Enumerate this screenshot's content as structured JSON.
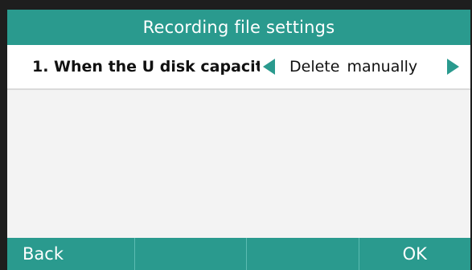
{
  "title": "Recording file settings",
  "setting": {
    "label": "1. When the U disk capacit",
    "value": "Delete manually"
  },
  "softkeys": [
    "Back",
    "",
    "",
    "OK"
  ],
  "colors": {
    "accent": "#2a9a8e",
    "row_background": "#ffffff",
    "screen_background": "#f3f3f3"
  },
  "icons": {
    "previous": "left-triangle",
    "next": "right-triangle"
  }
}
